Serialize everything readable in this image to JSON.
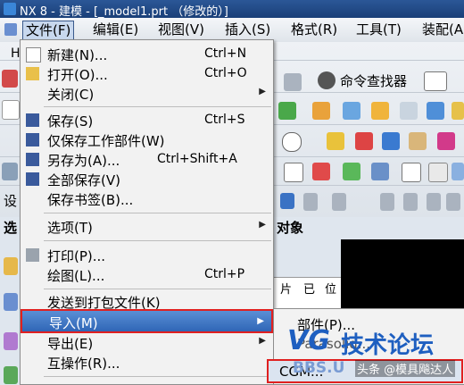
{
  "window": {
    "title": "NX 8 - 建模 - [_model1.prt （修改的）]"
  },
  "menubar": {
    "items": [
      "文件(F)",
      "编辑(E)",
      "视图(V)",
      "插入(S)",
      "格式(R)",
      "工具(T)",
      "装配(A"
    ]
  },
  "toolbar": {
    "command_finder": "命令查找器",
    "select_label": "选",
    "obj_fragment": "对象",
    "left_char_h": "H",
    "left_char_she": "设"
  },
  "file_menu": {
    "items": [
      {
        "label": "新建(N)...",
        "shortcut": "Ctrl+N"
      },
      {
        "label": "打开(O)...",
        "shortcut": "Ctrl+O"
      },
      {
        "label": "关闭(C)",
        "shortcut": ""
      },
      {
        "label": "保存(S)",
        "shortcut": "Ctrl+S"
      },
      {
        "label": "仅保存工作部件(W)",
        "shortcut": ""
      },
      {
        "label": "另存为(A)...",
        "shortcut": "Ctrl+Shift+A"
      },
      {
        "label": "全部保存(V)",
        "shortcut": ""
      },
      {
        "label": "保存书签(B)...",
        "shortcut": ""
      },
      {
        "label": "选项(T)",
        "shortcut": ""
      },
      {
        "label": "打印(P)...",
        "shortcut": ""
      },
      {
        "label": "绘图(L)...",
        "shortcut": "Ctrl+P"
      },
      {
        "label": "发送到打包文件(K)",
        "shortcut": ""
      },
      {
        "label": "导入(M)",
        "shortcut": ""
      },
      {
        "label": "导出(E)",
        "shortcut": ""
      },
      {
        "label": "互操作(R)...",
        "shortcut": ""
      }
    ]
  },
  "import_submenu": {
    "items": [
      "部件(P)...",
      "Parasolid...",
      "CGM..."
    ]
  },
  "table_fragment": {
    "cells": [
      "片",
      "已",
      "位"
    ]
  },
  "watermark": {
    "brand": "技术论坛",
    "url": "BBS.U",
    "credit": "头条 @模具飚达人"
  },
  "colors": {
    "highlight": "#e02020",
    "menu_selected": "#3a72c4"
  }
}
